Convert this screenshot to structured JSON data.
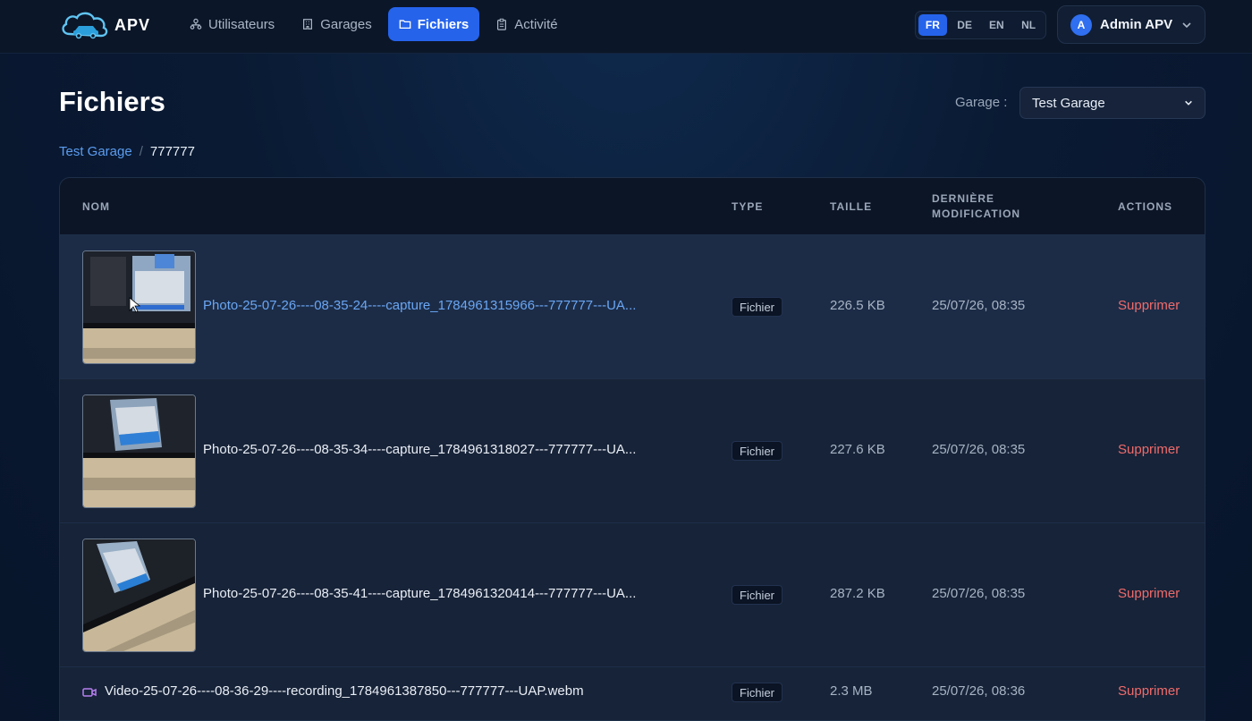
{
  "brand": {
    "name": "APV"
  },
  "nav": {
    "items": [
      {
        "label": "Utilisateurs",
        "icon": "users-icon"
      },
      {
        "label": "Garages",
        "icon": "building-icon"
      },
      {
        "label": "Fichiers",
        "icon": "folder-icon",
        "active": true
      },
      {
        "label": "Activité",
        "icon": "clipboard-icon"
      }
    ]
  },
  "languages": {
    "items": [
      "FR",
      "DE",
      "EN",
      "NL"
    ],
    "active": "FR"
  },
  "user": {
    "initial": "A",
    "name": "Admin APV"
  },
  "page": {
    "title": "Fichiers"
  },
  "garage_filter": {
    "label": "Garage :",
    "value": "Test Garage"
  },
  "breadcrumb": {
    "root": "Test Garage",
    "separator": "/",
    "current": "777777"
  },
  "table": {
    "headers": {
      "name": "NOM",
      "type": "TYPE",
      "size": "TAILLE",
      "modified_line1": "DERNIÈRE",
      "modified_line2": "MODIFICATION",
      "actions": "ACTIONS"
    },
    "rows": [
      {
        "name": "Photo-25-07-26----08-35-24----capture_1784961315966---777777---UA...",
        "type": "Fichier",
        "size": "226.5 KB",
        "modified": "25/07/26, 08:35",
        "action": "Supprimer",
        "kind": "image",
        "highlighted": true
      },
      {
        "name": "Photo-25-07-26----08-35-34----capture_1784961318027---777777---UA...",
        "type": "Fichier",
        "size": "227.6 KB",
        "modified": "25/07/26, 08:35",
        "action": "Supprimer",
        "kind": "image"
      },
      {
        "name": "Photo-25-07-26----08-35-41----capture_1784961320414---777777---UA...",
        "type": "Fichier",
        "size": "287.2 KB",
        "modified": "25/07/26, 08:35",
        "action": "Supprimer",
        "kind": "image"
      },
      {
        "name": "Video-25-07-26----08-36-29----recording_1784961387850---777777---UAP.webm",
        "type": "Fichier",
        "size": "2.3 MB",
        "modified": "25/07/26, 08:36",
        "action": "Supprimer",
        "kind": "video"
      }
    ]
  },
  "colors": {
    "accent": "#2563eb",
    "link": "#6aa6f3",
    "danger": "#ef6b6b"
  }
}
